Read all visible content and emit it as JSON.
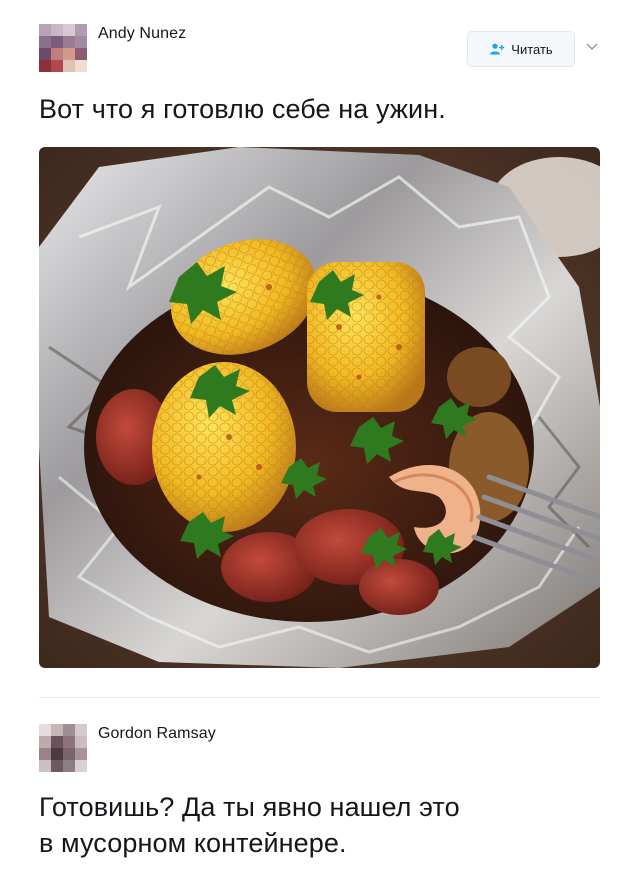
{
  "tweet1": {
    "author": "Andy Nunez",
    "follow_label": "Читать",
    "text": "Вот что я готовлю себе на ужин.",
    "photo_icon": "foil-food-photo"
  },
  "tweet2": {
    "author": "Gordon Ramsay",
    "text_line1": "Готовишь? Да ты явно нашел это",
    "text_line2": "в мусорном контейнере."
  },
  "colors": {
    "link_blue": "#1da1f2",
    "text": "#14171a",
    "border": "#e1e8ed"
  },
  "icons": {
    "follow": "add-user-icon",
    "menu": "chevron-down-icon"
  }
}
